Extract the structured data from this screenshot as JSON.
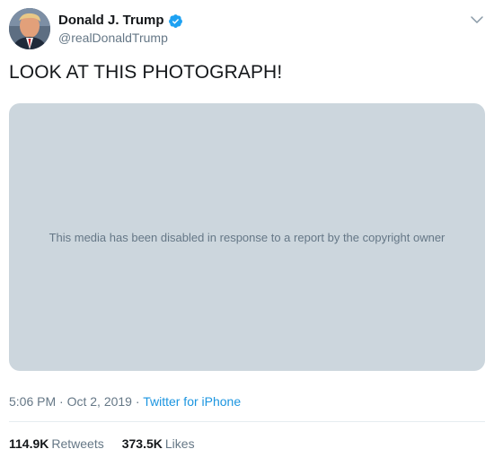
{
  "author": {
    "display_name": "Donald J. Trump",
    "handle": "@realDonaldTrump",
    "verified_icon": "verified-badge-icon",
    "avatar_icon": "avatar"
  },
  "tweet": {
    "text": "LOOK AT THIS PHOTOGRAPH!"
  },
  "media": {
    "notice": "This media has been disabled in response to a report by the copyright owner"
  },
  "meta": {
    "time": "5:06 PM",
    "separator1": " · ",
    "date": "Oct 2, 2019",
    "separator2": " · ",
    "source": "Twitter for iPhone"
  },
  "stats": {
    "retweets_count": "114.9K",
    "retweets_label": "Retweets",
    "likes_count": "373.5K",
    "likes_label": "Likes"
  },
  "colors": {
    "accent": "#1b95e0",
    "verified": "#1da1f2",
    "secondary_text": "#657786",
    "media_bg": "#ccd6dd"
  }
}
